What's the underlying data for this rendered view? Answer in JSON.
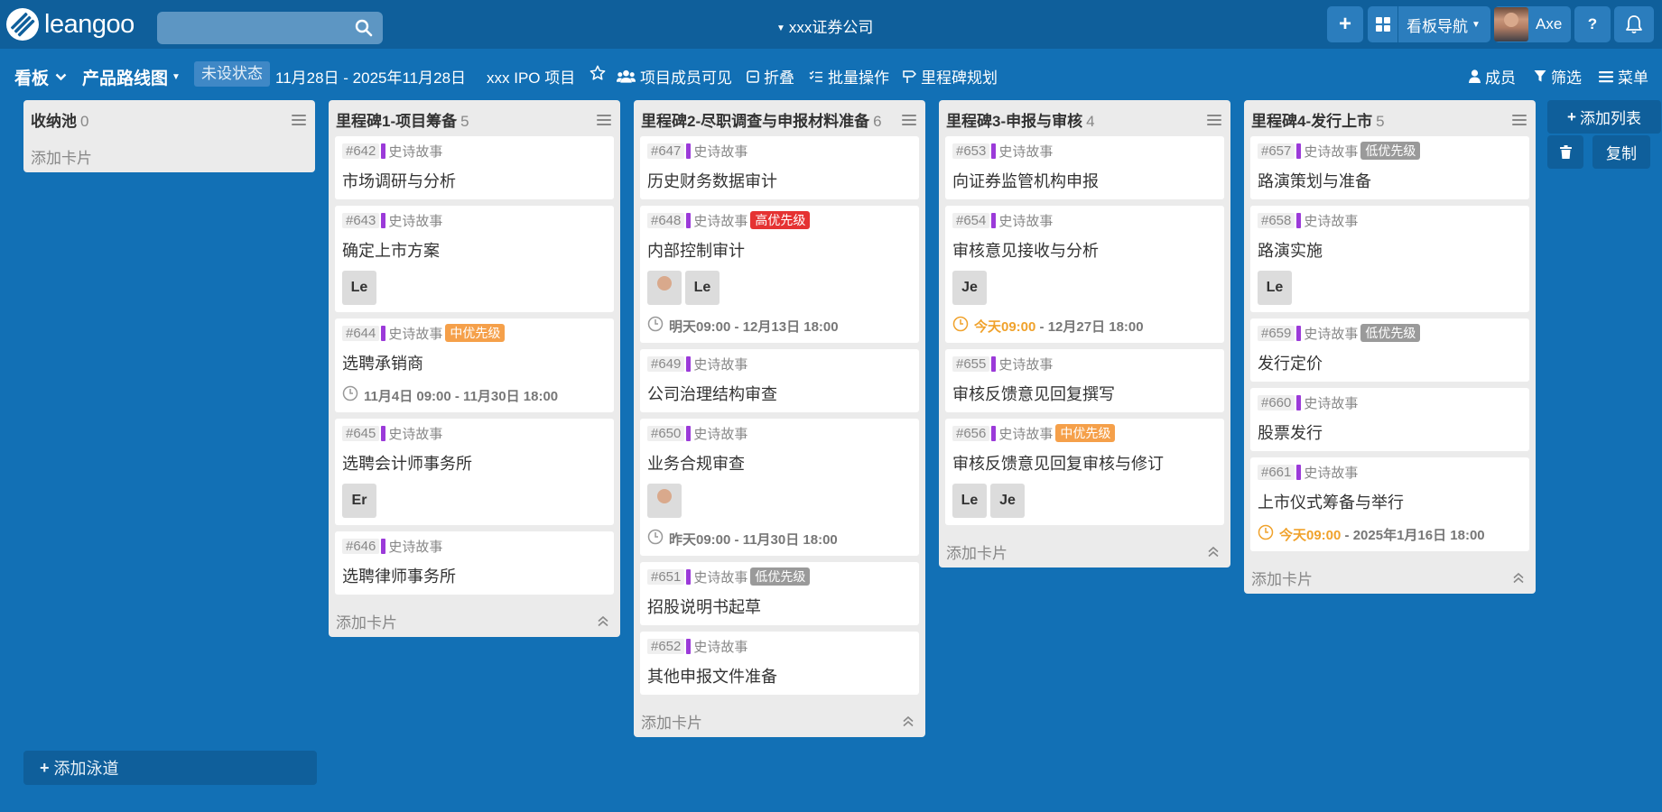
{
  "app": {
    "logo_text": "leangoo"
  },
  "search": {
    "placeholder": ""
  },
  "header": {
    "company": "xxx证券公司",
    "nav_label": "看板导航",
    "user_name": "Axe",
    "help_label": "?"
  },
  "board": {
    "view_label": "看板",
    "board_name": "产品路线图",
    "status": "未设状态",
    "date_range": "11月28日 - 2025年11月28日",
    "project": "xxx IPO 项目",
    "visibility": "项目成员可见",
    "fold": "折叠",
    "batch": "批量操作",
    "milestone": "里程碑规划",
    "members": "成员",
    "filter": "筛选",
    "menu": "菜单"
  },
  "labels": {
    "add_card": "添加卡片",
    "epic": "史诗故事"
  },
  "lists": [
    {
      "name": "收纳池",
      "count": "0",
      "cards": []
    },
    {
      "name": "里程碑1-项目筹备",
      "count": "5",
      "cards": [
        {
          "num": "#642",
          "title": "市场调研与分析"
        },
        {
          "num": "#643",
          "title": "确定上市方案",
          "members": [
            "Le"
          ]
        },
        {
          "num": "#644",
          "priority": "中优先级",
          "title": "选聘承销商",
          "due": "11月4日 09:00 - 11月30日 18:00"
        },
        {
          "num": "#645",
          "title": "选聘会计师事务所",
          "members": [
            "Er"
          ]
        },
        {
          "num": "#646",
          "title": "选聘律师事务所"
        }
      ]
    },
    {
      "name": "里程碑2-尽职调查与申报材料准备",
      "count": "6",
      "cards": [
        {
          "num": "#647",
          "title": "历史财务数据审计"
        },
        {
          "num": "#648",
          "priority": "高优先级",
          "title": "内部控制审计",
          "members": [
            "Le"
          ],
          "due": "明天09:00 - 12月13日 18:00"
        },
        {
          "num": "#649",
          "title": "公司治理结构审查"
        },
        {
          "num": "#650",
          "title": "业务合规审查",
          "due": "昨天09:00 - 11月30日 18:00"
        },
        {
          "num": "#651",
          "priority": "低优先级",
          "title": "招股说明书起草"
        },
        {
          "num": "#652",
          "title": "其他申报文件准备"
        }
      ]
    },
    {
      "name": "里程碑3-申报与审核",
      "count": "4",
      "cards": [
        {
          "num": "#653",
          "title": "向证券监管机构申报"
        },
        {
          "num": "#654",
          "title": "审核意见接收与分析",
          "members": [
            "Je"
          ],
          "due_today": "今天09:00",
          "due_rest": " - 12月27日 18:00"
        },
        {
          "num": "#655",
          "title": "审核反馈意见回复撰写"
        },
        {
          "num": "#656",
          "priority": "中优先级",
          "title": "审核反馈意见回复审核与修订",
          "members": [
            "Le",
            "Je"
          ]
        }
      ]
    },
    {
      "name": "里程碑4-发行上市",
      "count": "5",
      "cards": [
        {
          "num": "#657",
          "priority": "低优先级",
          "title": "路演策划与准备"
        },
        {
          "num": "#658",
          "title": "路演实施",
          "members": [
            "Le"
          ]
        },
        {
          "num": "#659",
          "priority": "低优先级",
          "title": "发行定价"
        },
        {
          "num": "#660",
          "title": "股票发行"
        },
        {
          "num": "#661",
          "title": "上市仪式筹备与举行",
          "due_today": "今天09:00",
          "due_rest": " - 2025年1月16日 18:00"
        }
      ]
    }
  ],
  "side": {
    "add_list": "添加列表",
    "copy": "复制"
  },
  "swimlane": {
    "add": "添加泳道"
  },
  "colors": {
    "background": "#1270b5",
    "topbar": "#0f5f9b",
    "epic": "#9b3ad9",
    "high": "#e53232",
    "mid": "#f5a04a",
    "low": "#9a9a9a",
    "today": "#f0a22c"
  }
}
